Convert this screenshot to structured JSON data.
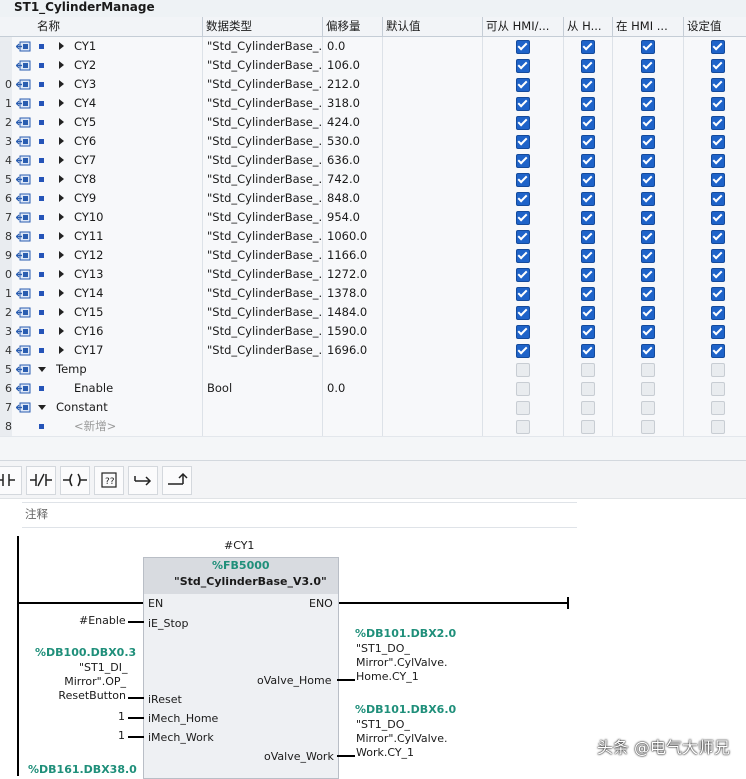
{
  "block_title": "ST1_CylinderManage",
  "columns": {
    "name": "名称",
    "data_type": "数据类型",
    "offset": "偏移量",
    "default": "默认值",
    "hmi_access": "可从 HMI/...",
    "hmi_write": "从 H...",
    "hmi_visible": "在 HMI ...",
    "setpoint": "设定值"
  },
  "rows": [
    {
      "num": "",
      "name": "CY1",
      "type": "\"Std_CylinderBase_...",
      "offset": "0.0",
      "kind": "member",
      "checks": [
        true,
        true,
        true,
        true
      ]
    },
    {
      "num": "",
      "name": "CY2",
      "type": "\"Std_CylinderBase_...",
      "offset": "106.0",
      "kind": "member",
      "checks": [
        true,
        true,
        true,
        true
      ]
    },
    {
      "num": "0",
      "name": "CY3",
      "type": "\"Std_CylinderBase_...",
      "offset": "212.0",
      "kind": "member",
      "checks": [
        true,
        true,
        true,
        true
      ]
    },
    {
      "num": "1",
      "name": "CY4",
      "type": "\"Std_CylinderBase_...",
      "offset": "318.0",
      "kind": "member",
      "checks": [
        true,
        true,
        true,
        true
      ]
    },
    {
      "num": "2",
      "name": "CY5",
      "type": "\"Std_CylinderBase_...",
      "offset": "424.0",
      "kind": "member",
      "checks": [
        true,
        true,
        true,
        true
      ]
    },
    {
      "num": "3",
      "name": "CY6",
      "type": "\"Std_CylinderBase_...",
      "offset": "530.0",
      "kind": "member",
      "checks": [
        true,
        true,
        true,
        true
      ]
    },
    {
      "num": "4",
      "name": "CY7",
      "type": "\"Std_CylinderBase_...",
      "offset": "636.0",
      "kind": "member",
      "checks": [
        true,
        true,
        true,
        true
      ]
    },
    {
      "num": "5",
      "name": "CY8",
      "type": "\"Std_CylinderBase_...",
      "offset": "742.0",
      "kind": "member",
      "checks": [
        true,
        true,
        true,
        true
      ]
    },
    {
      "num": "6",
      "name": "CY9",
      "type": "\"Std_CylinderBase_...",
      "offset": "848.0",
      "kind": "member",
      "checks": [
        true,
        true,
        true,
        true
      ]
    },
    {
      "num": "7",
      "name": "CY10",
      "type": "\"Std_CylinderBase_...",
      "offset": "954.0",
      "kind": "member",
      "checks": [
        true,
        true,
        true,
        true
      ]
    },
    {
      "num": "8",
      "name": "CY11",
      "type": "\"Std_CylinderBase_...",
      "offset": "1060.0",
      "kind": "member",
      "checks": [
        true,
        true,
        true,
        true
      ]
    },
    {
      "num": "9",
      "name": "CY12",
      "type": "\"Std_CylinderBase_...",
      "offset": "1166.0",
      "kind": "member",
      "checks": [
        true,
        true,
        true,
        true
      ]
    },
    {
      "num": "0",
      "name": "CY13",
      "type": "\"Std_CylinderBase_...",
      "offset": "1272.0",
      "kind": "member",
      "checks": [
        true,
        true,
        true,
        true
      ]
    },
    {
      "num": "1",
      "name": "CY14",
      "type": "\"Std_CylinderBase_...",
      "offset": "1378.0",
      "kind": "member",
      "checks": [
        true,
        true,
        true,
        true
      ]
    },
    {
      "num": "2",
      "name": "CY15",
      "type": "\"Std_CylinderBase_...",
      "offset": "1484.0",
      "kind": "member",
      "checks": [
        true,
        true,
        true,
        true
      ]
    },
    {
      "num": "3",
      "name": "CY16",
      "type": "\"Std_CylinderBase_...",
      "offset": "1590.0",
      "kind": "member",
      "checks": [
        true,
        true,
        true,
        true
      ]
    },
    {
      "num": "4",
      "name": "CY17",
      "type": "\"Std_CylinderBase_...",
      "offset": "1696.0",
      "kind": "member",
      "checks": [
        true,
        true,
        true,
        true
      ]
    },
    {
      "num": "5",
      "name": "Temp",
      "type": "",
      "offset": "",
      "kind": "section",
      "checks": [
        false,
        false,
        false,
        false
      ]
    },
    {
      "num": "6",
      "name": "Enable",
      "type": "Bool",
      "offset": "0.0",
      "kind": "leaf",
      "checks": [
        false,
        false,
        false,
        false
      ]
    },
    {
      "num": "7",
      "name": "Constant",
      "type": "",
      "offset": "",
      "kind": "section",
      "checks": [
        false,
        false,
        false,
        false
      ]
    },
    {
      "num": "8",
      "name": "<新增>",
      "type": "",
      "offset": "",
      "kind": "add",
      "checks": [
        false,
        false,
        false,
        false
      ]
    }
  ],
  "toolbar": {
    "items": [
      "no-contact",
      "nc-contact",
      "coil",
      "empty-box",
      "open-branch",
      "close-branch"
    ]
  },
  "comment_label": "注释",
  "ladder": {
    "instance_tag": "#CY1",
    "fb_number": "%FB5000",
    "fb_name": "\"Std_CylinderBase_V3.0\"",
    "en": "EN",
    "eno": "ENO",
    "pins_in": [
      {
        "label": "iE_Stop",
        "operand": "#Enable"
      },
      {
        "label": "iReset",
        "address": "%DB100.DBX0.3",
        "operand_lines": [
          "\"ST1_DI_",
          "Mirror\".OP_",
          "ResetButton"
        ]
      },
      {
        "label": "iMech_Home",
        "operand": "1"
      },
      {
        "label": "iMech_Work",
        "operand": "1"
      }
    ],
    "pins_out": [
      {
        "label": "oValve_Home",
        "address": "%DB101.DBX2.0",
        "operand_lines": [
          "\"ST1_DO_",
          "Mirror\".CylValve.",
          "Home.CY_1"
        ]
      },
      {
        "label": "oValve_Work",
        "address": "%DB101.DBX6.0",
        "operand_lines": [
          "\"ST1_DO_",
          "Mirror\".CylValve.",
          "Work.CY_1"
        ]
      }
    ],
    "bottom_address": "%DB161.DBX38.0"
  },
  "watermark": "头条 @电气大师兄"
}
